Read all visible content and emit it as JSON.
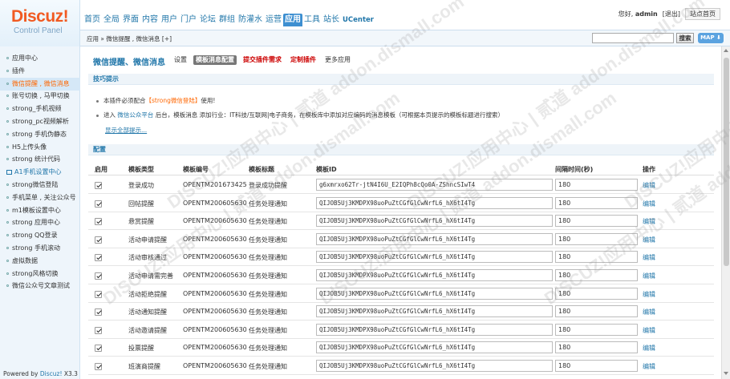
{
  "header": {
    "logo": "Discuz!",
    "logo_sub": "Control Panel",
    "nav": [
      "首页",
      "全局",
      "界面",
      "内容",
      "用户",
      "门户",
      "论坛",
      "群组",
      "防灌水",
      "运营",
      "应用",
      "工具",
      "站长",
      "UCenter"
    ],
    "nav_active_index": 10,
    "greeting": "您好,",
    "username": "admin",
    "logout": "[退出]",
    "site_home": "站点首页"
  },
  "breadcrumb": "应用 » 微信提醒 , 微信消息   [+]",
  "search": {
    "button": "搜索",
    "map": "MAP ⬇"
  },
  "sidebar": {
    "items": [
      "应用中心",
      "插件",
      "微信提醒 , 微信消息",
      "账号切换 , 马甲切换",
      "strong_手机视频",
      "strong_pc视频解析",
      "strong 手机伪静态",
      "H5上传头像",
      "strong 统计代码",
      "A1手机设置中心",
      "strong微信登陆",
      "手机菜单 , 关注公众号",
      "m1模板设置中心",
      "strong 应用中心",
      "strong QQ登录",
      "strong 手机滚动",
      "虚拟数据",
      "strong风格切换",
      "微信公众号文章测试"
    ],
    "active_index": 2,
    "a1_index": 9,
    "powered_prefix": "Powered by",
    "powered_brand": "Discuz!",
    "powered_ver": "X3.3"
  },
  "page": {
    "title": "微信提醒、微信消息",
    "tabs": [
      "设置",
      "模板消息配置",
      "提交插件需求",
      "定制插件",
      "更多应用"
    ],
    "active_tab": 1,
    "red_tabs": [
      2,
      3
    ]
  },
  "tips": {
    "section": "技巧提示",
    "line1_pre": "本插件必须配合",
    "line1_hl": "【strong微信登陆】",
    "line1_post": "使用!",
    "line2_pre": "进入",
    "line2_link": "微信公众平台",
    "line2_post": "后台，模板消息 添加行业：IT科技/互联网|电子商务，在模板库中添加对应编码的消息模板（可根据本页提示的模板标题进行搜索）",
    "show_all": "显示全部提示..."
  },
  "config": {
    "section": "配置",
    "columns": [
      "启用",
      "模板类型",
      "模板编号",
      "模板标题",
      "模板ID",
      "间隔时间(秒)",
      "操作"
    ],
    "rows": [
      {
        "type": "登录成功",
        "code": "OPENTM201673425",
        "title": "登录成功提醒",
        "tid": "g6xmrxo62Tr-jtN4I6U_E2IQPh8cQo0A-ZShncSIwT4",
        "interval": "180",
        "op": "编辑"
      },
      {
        "type": "回帖提醒",
        "code": "OPENTM200605630",
        "title": "任务处理通知",
        "tid": "QIJOB5Uj3KMDPX98uoPuZtCGfGlCwNrfL6_hX6tI4Tg",
        "interval": "180",
        "op": "编辑"
      },
      {
        "type": "悬赏提醒",
        "code": "OPENTM200605630",
        "title": "任务处理通知",
        "tid": "QIJOB5Uj3KMDPX98uoPuZtCGfGlCwNrfL6_hX6tI4Tg",
        "interval": "180",
        "op": "编辑"
      },
      {
        "type": "活动申请提醒",
        "code": "OPENTM200605630",
        "title": "任务处理通知",
        "tid": "QIJOB5Uj3KMDPX98uoPuZtCGfGlCwNrfL6_hX6tI4Tg",
        "interval": "180",
        "op": "编辑"
      },
      {
        "type": "活动审核通过",
        "code": "OPENTM200605630",
        "title": "任务处理通知",
        "tid": "QIJOB5Uj3KMDPX98uoPuZtCGfGlCwNrfL6_hX6tI4Tg",
        "interval": "180",
        "op": "编辑"
      },
      {
        "type": "活动申请需完善",
        "code": "OPENTM200605630",
        "title": "任务处理通知",
        "tid": "QIJOB5Uj3KMDPX98uoPuZtCGfGlCwNrfL6_hX6tI4Tg",
        "interval": "180",
        "op": "编辑"
      },
      {
        "type": "活动拒绝提醒",
        "code": "OPENTM200605630",
        "title": "任务处理通知",
        "tid": "QIJOB5Uj3KMDPX98uoPuZtCGfGlCwNrfL6_hX6tI4Tg",
        "interval": "180",
        "op": "编辑"
      },
      {
        "type": "活动通知提醒",
        "code": "OPENTM200605630",
        "title": "任务处理通知",
        "tid": "QIJOB5Uj3KMDPX98uoPuZtCGfGlCwNrfL6_hX6tI4Tg",
        "interval": "180",
        "op": "编辑"
      },
      {
        "type": "活动邀请提醒",
        "code": "OPENTM200605630",
        "title": "任务处理通知",
        "tid": "QIJOB5Uj3KMDPX98uoPuZtCGfGlCwNrfL6_hX6tI4Tg",
        "interval": "180",
        "op": "编辑"
      },
      {
        "type": "投票提醒",
        "code": "OPENTM200605630",
        "title": "任务处理通知",
        "tid": "QIJOB5Uj3KMDPX98uoPuZtCGfGlCwNrfL6_hX6tI4Tg",
        "interval": "180",
        "op": "编辑"
      },
      {
        "type": "班演商提醒",
        "code": "OPENTM200605630",
        "title": "任务处理通知",
        "tid": "QIJOB5Uj3KMDPX98uoPuZtCGfGlCwNrfL6_hX6tI4Tg",
        "interval": "180",
        "op": "编辑"
      }
    ]
  },
  "watermark": "DISCUZ!应用中心 | 贰道 addon.dismall.com"
}
